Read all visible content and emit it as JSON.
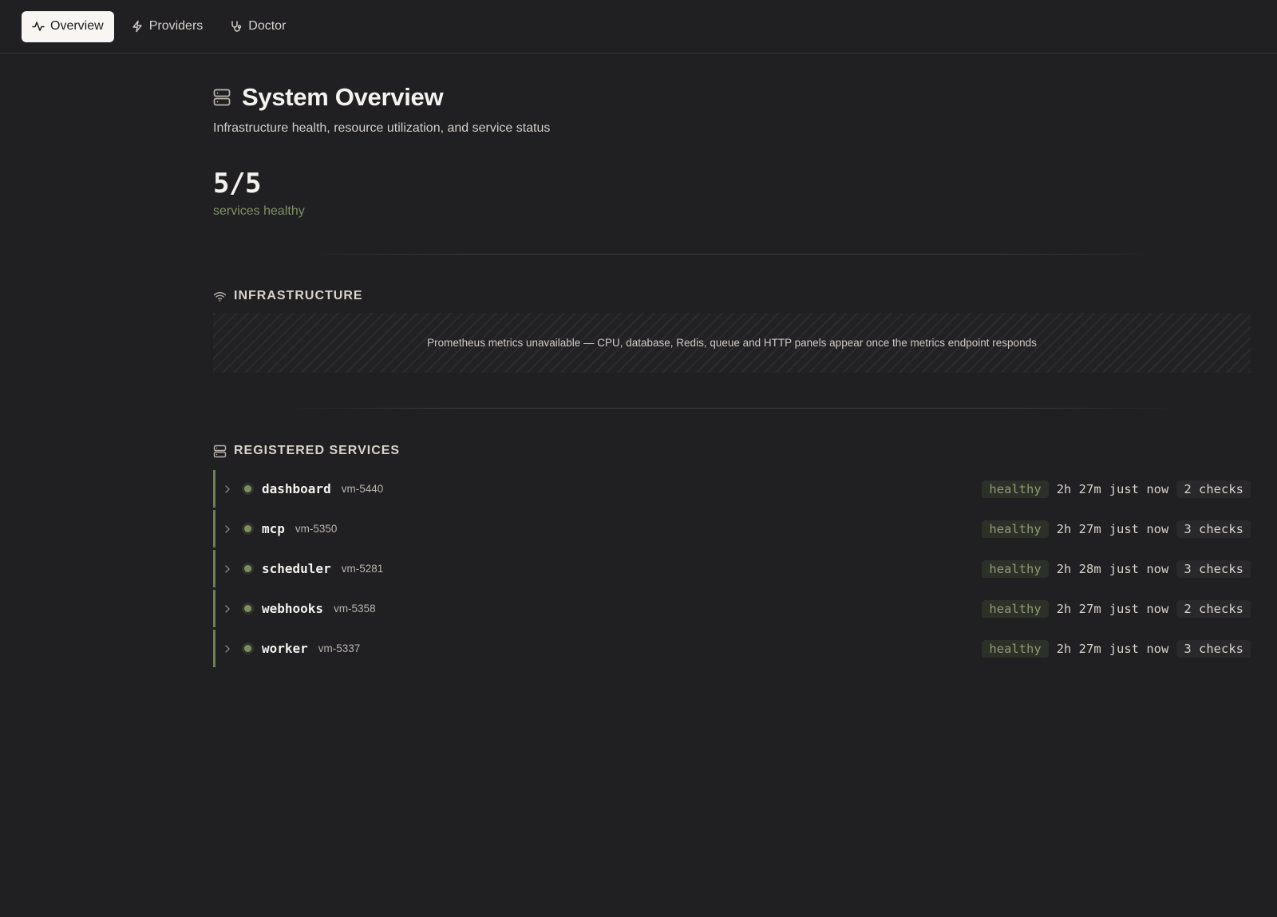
{
  "nav": {
    "tabs": [
      {
        "label": "Overview",
        "icon": "activity-icon",
        "active": true
      },
      {
        "label": "Providers",
        "icon": "lightning-icon",
        "active": false
      },
      {
        "label": "Doctor",
        "icon": "stethoscope-icon",
        "active": false
      }
    ]
  },
  "header": {
    "title": "System Overview",
    "subtitle": "Infrastructure health, resource utilization, and service status",
    "icon": "server-icon"
  },
  "summary": {
    "value": "5/5",
    "label": "services healthy"
  },
  "infrastructure": {
    "heading": "INFRASTRUCTURE",
    "icon": "wifi-icon",
    "empty_message": "Prometheus metrics unavailable — CPU, database, Redis, queue and HTTP panels appear once the metrics endpoint responds"
  },
  "services_section": {
    "heading": "REGISTERED SERVICES",
    "icon": "server-icon",
    "items": [
      {
        "name": "dashboard",
        "host": "vm-5440",
        "status": "healthy",
        "uptime": "2h 27m",
        "last_check": "just now",
        "checks": "2 checks"
      },
      {
        "name": "mcp",
        "host": "vm-5350",
        "status": "healthy",
        "uptime": "2h 27m",
        "last_check": "just now",
        "checks": "3 checks"
      },
      {
        "name": "scheduler",
        "host": "vm-5281",
        "status": "healthy",
        "uptime": "2h 28m",
        "last_check": "just now",
        "checks": "3 checks"
      },
      {
        "name": "webhooks",
        "host": "vm-5358",
        "status": "healthy",
        "uptime": "2h 27m",
        "last_check": "just now",
        "checks": "2 checks"
      },
      {
        "name": "worker",
        "host": "vm-5337",
        "status": "healthy",
        "uptime": "2h 27m",
        "last_check": "just now",
        "checks": "3 checks"
      }
    ]
  },
  "colors": {
    "background": "#201f22",
    "accent_green": "#7d8f60",
    "active_tab": "#f7f6f3"
  }
}
